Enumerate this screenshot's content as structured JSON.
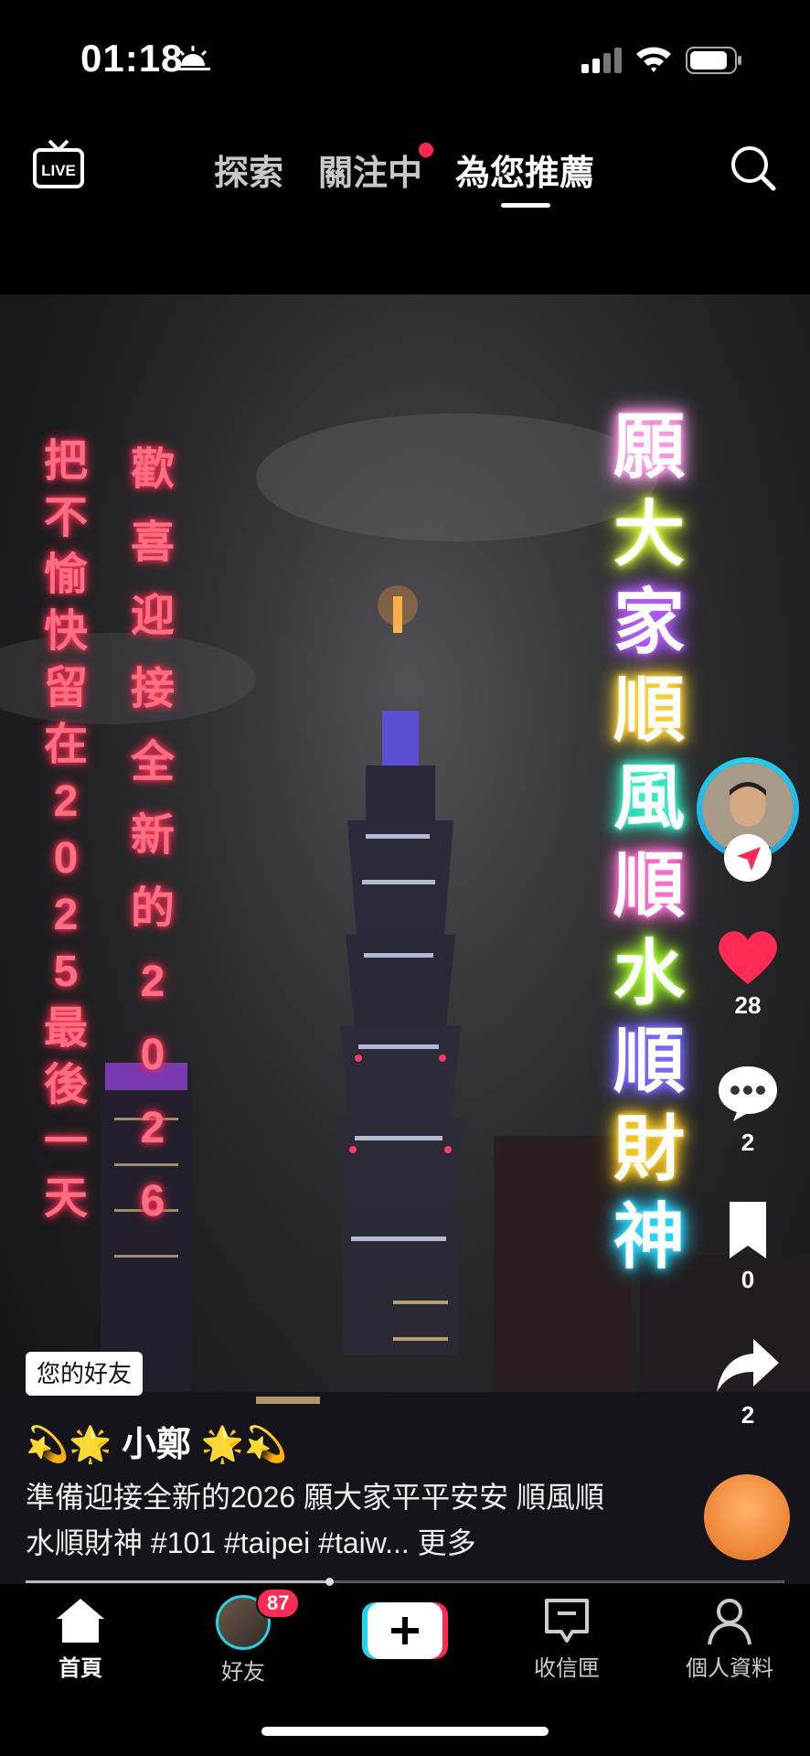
{
  "status_bar": {
    "time": "01:18",
    "icons": [
      "sunrise-icon",
      "cellular-signal-icon",
      "wifi-icon",
      "battery-icon"
    ]
  },
  "top_nav": {
    "live_icon": "live-icon",
    "tabs": [
      {
        "label": "探索",
        "active": false
      },
      {
        "label": "關注中",
        "active": false,
        "notification_dot": true
      },
      {
        "label": "為您推薦",
        "active": true
      }
    ],
    "search_icon": "search-icon"
  },
  "video": {
    "overlay_left_col1": [
      "把",
      "不",
      "愉",
      "快",
      "留",
      "在",
      "2",
      "0",
      "2",
      "5",
      "最",
      "後",
      "一",
      "天"
    ],
    "overlay_left_col2": [
      "歡",
      "喜",
      "迎",
      "接",
      "全",
      "新",
      "的",
      "2",
      "0",
      "2",
      "6"
    ],
    "overlay_right_col": [
      {
        "char": "願",
        "color": "#ff9ae8"
      },
      {
        "char": "大",
        "color": "#d7ff3a"
      },
      {
        "char": "家",
        "color": "#b45cff"
      },
      {
        "char": "順",
        "color": "#ffd23a"
      },
      {
        "char": "風",
        "color": "#39f0c8"
      },
      {
        "char": "順",
        "color": "#ff6fd0"
      },
      {
        "char": "水",
        "color": "#a8ff30"
      },
      {
        "char": "順",
        "color": "#7a6bff"
      },
      {
        "char": "財",
        "color": "#ffcf2a"
      },
      {
        "char": "神",
        "color": "#2ad8ff"
      }
    ]
  },
  "side_actions": {
    "likes": "28",
    "comments": "2",
    "saves": "0",
    "shares": "2"
  },
  "post": {
    "friend_label": "您的好友",
    "username": "💫🌟 小鄭 🌟💫",
    "caption": "準備迎接全新的2026 願大家平平安安 順風順水順財神 #101  #taipei  #taiw... 更多",
    "progress": 0.4
  },
  "bottom_nav": {
    "items": [
      {
        "label": "首頁",
        "icon": "home-icon",
        "active": true
      },
      {
        "label": "好友",
        "icon": "friends-avatar",
        "badge": "87"
      },
      {
        "label": "",
        "icon": "create-plus-icon"
      },
      {
        "label": "收信匣",
        "icon": "inbox-icon"
      },
      {
        "label": "個人資料",
        "icon": "profile-icon"
      }
    ]
  },
  "colors": {
    "accent_red": "#ff2b55",
    "accent_cyan": "#20d5ec",
    "overlay_pink": "#ff6f82"
  }
}
